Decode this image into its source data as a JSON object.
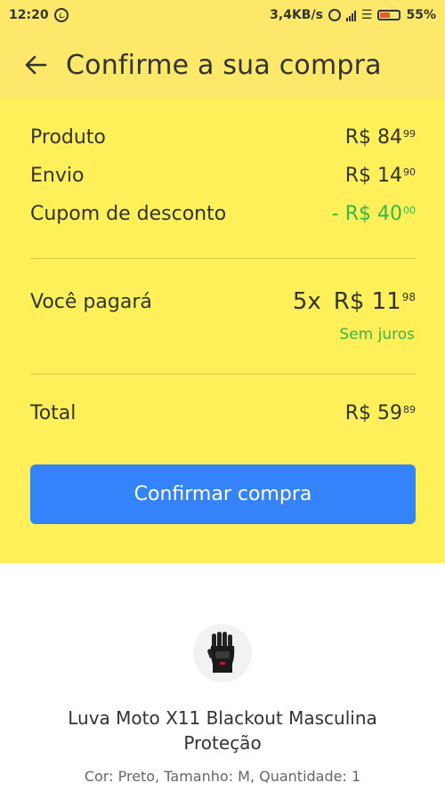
{
  "status_bar": {
    "time": "12:20",
    "network_speed": "3,4KB/s",
    "battery_percent": "55%",
    "icons": [
      "whatsapp-icon",
      "alarm-icon",
      "signal-icon",
      "wifi-icon",
      "battery-icon"
    ]
  },
  "header": {
    "title": "Confirme a sua compra",
    "back_icon": "arrow-left-icon"
  },
  "summary": {
    "product": {
      "label": "Produto",
      "currency": "R$",
      "whole": "84",
      "cents": "99"
    },
    "shipping": {
      "label": "Envio",
      "currency": "R$",
      "whole": "14",
      "cents": "90"
    },
    "coupon": {
      "label": "Cupom de desconto",
      "prefix": "- R$",
      "whole": "40",
      "cents": "00"
    },
    "installments": {
      "label": "Você pagará",
      "count": "5x",
      "currency": "R$",
      "whole": "11",
      "cents": "98",
      "note": "Sem juros"
    },
    "total": {
      "label": "Total",
      "currency": "R$",
      "whole": "59",
      "cents": "89"
    }
  },
  "confirm_button": {
    "label": "Confirmar compra"
  },
  "product_item": {
    "name": "Luva Moto X11 Blackout Masculina Proteção",
    "attributes": "Cor: Preto, Tamanho: M, Quantidade: 1",
    "image_icon": "glove-icon"
  },
  "colors": {
    "header_bg": "#fde86a",
    "summary_bg": "#fff059",
    "accent_blue": "#3483fa",
    "discount_green": "#39b54a",
    "text_dark": "#333333"
  }
}
